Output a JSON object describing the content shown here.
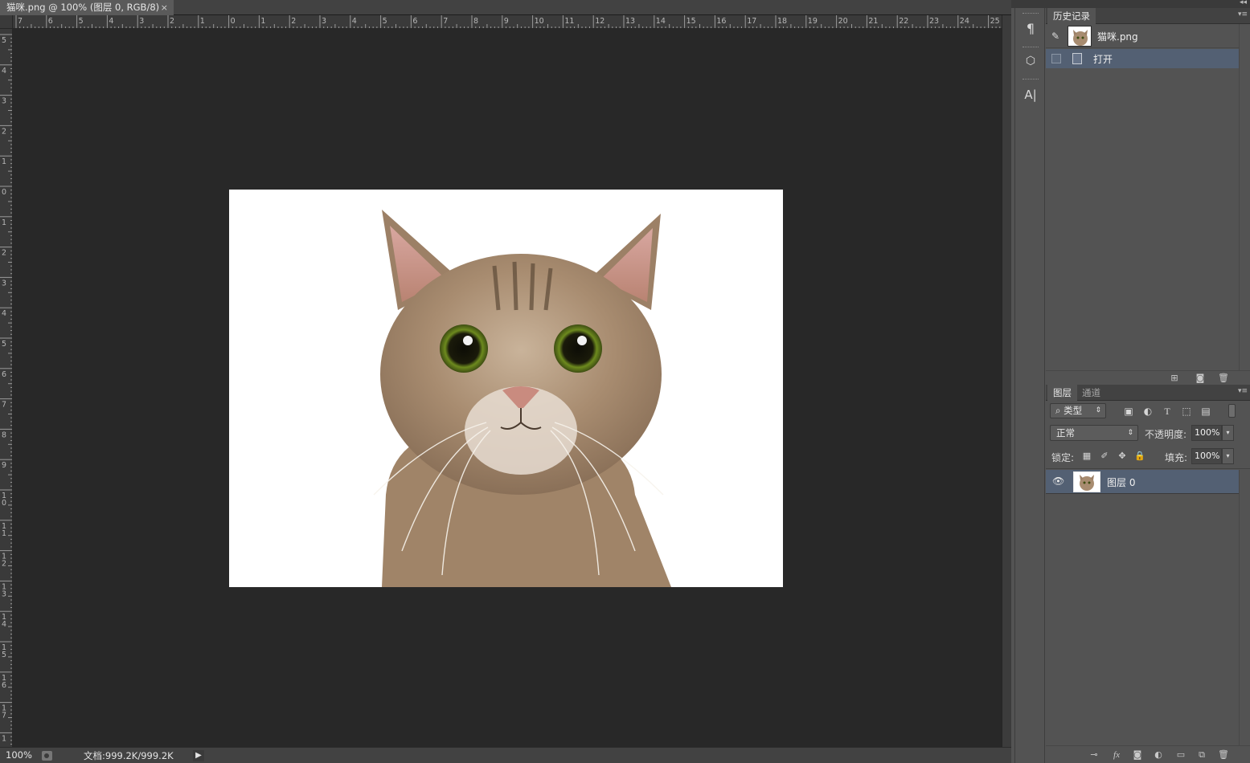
{
  "document": {
    "tab_title": "猫咪.png @ 100% (图层 0, RGB/8)",
    "tab_close": "×"
  },
  "ruler_h": {
    "labels": [
      "7",
      "6",
      "5",
      "4",
      "3",
      "2",
      "1",
      "0",
      "1",
      "2",
      "3",
      "4",
      "5",
      "6",
      "7",
      "8",
      "9",
      "10",
      "11",
      "12",
      "13",
      "14",
      "15",
      "16",
      "17",
      "18",
      "19",
      "20",
      "21",
      "22",
      "23",
      "24",
      "25"
    ]
  },
  "ruler_v": {
    "labels": [
      "5",
      "4",
      "3",
      "2",
      "1",
      "0",
      "1",
      "2",
      "3",
      "4",
      "5",
      "6",
      "7",
      "8",
      "9",
      "10",
      "11",
      "12",
      "13",
      "14",
      "15",
      "16",
      "17",
      "1"
    ]
  },
  "canvas": {
    "image_alt": "tabby cat portrait"
  },
  "status": {
    "zoom": "100%",
    "doc_info": "文档:999.2K/999.2K",
    "arrow": "▶"
  },
  "dock": {
    "collapse": "◂◂",
    "buttons": [
      {
        "icon": "paragraph-icon",
        "glyph": "¶"
      },
      {
        "icon": "3d-cube-icon",
        "glyph": "⬡"
      },
      {
        "icon": "character-icon",
        "glyph": "A|"
      }
    ]
  },
  "history_panel": {
    "tab_label": "历史记录",
    "menu": "▾≡",
    "snapshot_name": "猫咪.png",
    "items": [
      {
        "label": "打开"
      }
    ]
  },
  "layers_panel": {
    "tabs": [
      {
        "label": "图层",
        "active": true
      },
      {
        "label": "通道",
        "active": false
      }
    ],
    "menu": "▾≡",
    "kind_filter": "类型",
    "filter_icons": [
      "image-filter-icon",
      "adjustment-filter-icon",
      "type-filter-icon",
      "shape-filter-icon",
      "smart-object-filter-icon"
    ],
    "blend_mode": "正常",
    "opacity_label": "不透明度:",
    "opacity_value": "100%",
    "lock_label": "锁定:",
    "fill_label": "填充:",
    "fill_value": "100%",
    "layers": [
      {
        "name": "图层 0",
        "visible": true,
        "selected": true
      }
    ],
    "footer_icons": [
      "link-icon",
      "fx-icon",
      "mask-icon",
      "adjustment-icon",
      "group-folder-icon",
      "new-layer-icon",
      "trash-icon"
    ]
  },
  "colors": {
    "canvas_bg": "#282828",
    "panel_bg": "#535353",
    "selection": "#536073"
  }
}
